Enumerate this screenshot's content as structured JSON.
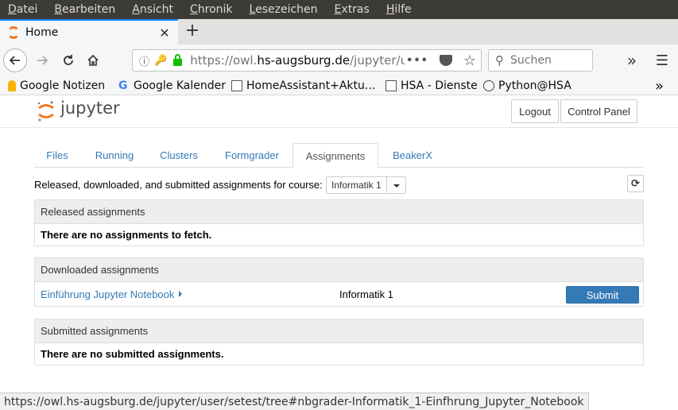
{
  "menubar": [
    "Datei",
    "Bearbeiten",
    "Ansicht",
    "Chronik",
    "Lesezeichen",
    "Extras",
    "Hilfe"
  ],
  "tab": {
    "title": "Home",
    "close": "✕",
    "new": "+"
  },
  "nav": {
    "url_prefix": "https://owl.",
    "url_domain": "hs-augsburg.de",
    "url_rest": "/jupyter/u",
    "search_placeholder": "Suchen"
  },
  "bookmarks": [
    "Google Notizen",
    "Google Kalender",
    "HomeAssistant+Aktu...",
    "HSA - Dienste",
    "Python@HSA"
  ],
  "jupyter": {
    "logo_text": "jupyter",
    "logout": "Logout",
    "control_panel": "Control Panel",
    "tabs": [
      "Files",
      "Running",
      "Clusters",
      "Formgrader",
      "Assignments",
      "BeakerX"
    ],
    "active_tab": "Assignments",
    "course_label": "Released, downloaded, and submitted assignments for course:",
    "course_selected": "Informatik 1",
    "released": {
      "heading": "Released assignments",
      "empty": "There are no assignments to fetch."
    },
    "downloaded": {
      "heading": "Downloaded assignments",
      "item_name": "Einführung Jupyter Notebook",
      "item_course": "Informatik 1",
      "submit": "Submit"
    },
    "submitted": {
      "heading": "Submitted assignments",
      "empty": "There are no submitted assignments."
    }
  },
  "statusbar": "https://owl.hs-augsburg.de/jupyter/user/setest/tree#nbgrader-Informatik_1-Einfhrung_Jupyter_Notebook",
  "colors": {
    "link": "#337ab7",
    "accent": "#0a84ff",
    "jupyter_orange": "#f37726"
  }
}
